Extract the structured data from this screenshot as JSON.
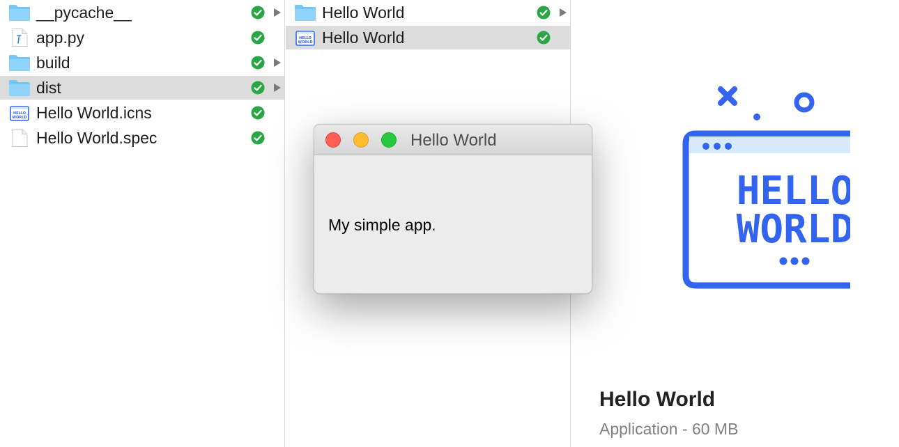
{
  "column1": {
    "items": [
      {
        "label": "__pycache__",
        "icon": "folder-icon",
        "selected": false,
        "has_arrow": true
      },
      {
        "label": "app.py",
        "icon": "python-file-icon",
        "selected": false,
        "has_arrow": false
      },
      {
        "label": "build",
        "icon": "folder-icon",
        "selected": false,
        "has_arrow": true
      },
      {
        "label": "dist",
        "icon": "folder-icon",
        "selected": true,
        "has_arrow": true
      },
      {
        "label": "Hello World.icns",
        "icon": "icns-file-icon",
        "selected": false,
        "has_arrow": false
      },
      {
        "label": "Hello World.spec",
        "icon": "document-icon",
        "selected": false,
        "has_arrow": false
      }
    ]
  },
  "column2": {
    "items": [
      {
        "label": "Hello World",
        "icon": "folder-icon",
        "selected": false,
        "has_arrow": true
      },
      {
        "label": "Hello World",
        "icon": "app-icon",
        "selected": true,
        "has_arrow": false
      }
    ]
  },
  "window": {
    "title": "Hello World",
    "body_text": "My simple app."
  },
  "preview": {
    "art_text_line1": "HELLO",
    "art_text_line2": "WORLD",
    "name": "Hello World",
    "info": "Application - 60 MB"
  },
  "colors": {
    "accent_blue": "#3264f0",
    "folder_blue": "#6cc3f5",
    "sync_green": "#29a744",
    "selection_gray": "#dcdcdc"
  }
}
